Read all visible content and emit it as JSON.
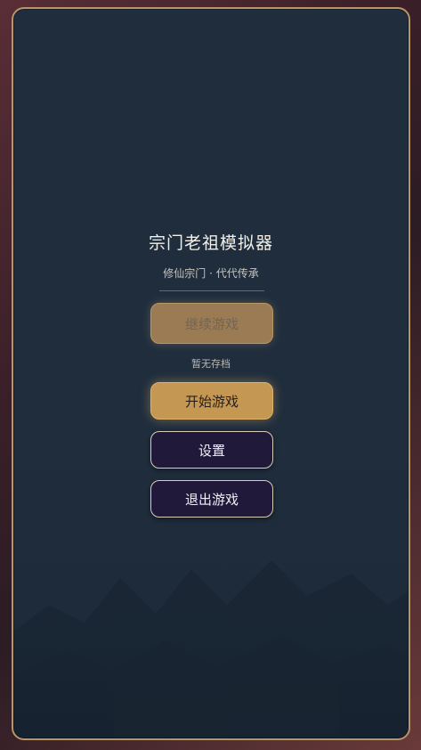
{
  "header": {
    "title": "宗门老祖模拟器",
    "subtitle": "修仙宗门 · 代代传承"
  },
  "menu": {
    "continue_label": "继续游戏",
    "no_save_text": "暂无存档",
    "start_label": "开始游戏",
    "settings_label": "设置",
    "exit_label": "退出游戏"
  },
  "colors": {
    "panel_bg": "#1f2d3d",
    "panel_border": "#b9936a",
    "primary_button": "#c49752",
    "dark_button": "#21193a"
  }
}
